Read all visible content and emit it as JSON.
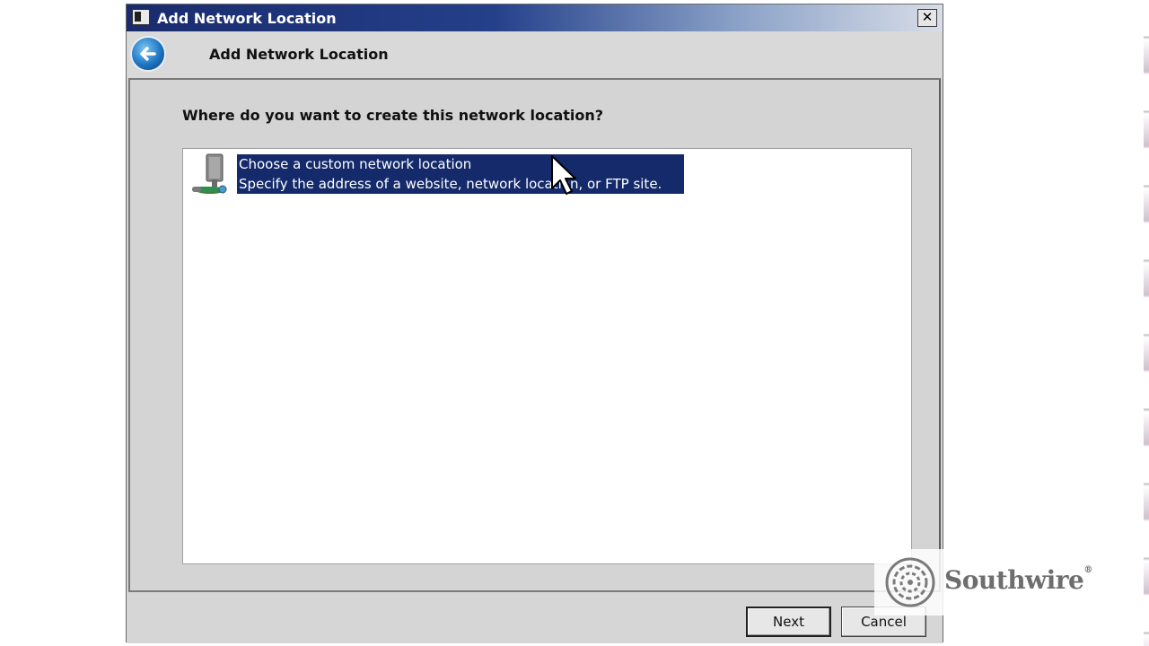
{
  "window": {
    "title": "Add Network Location",
    "close_glyph": "✕"
  },
  "header": {
    "back_icon": "back-arrow-icon",
    "title": "Add Network Location"
  },
  "main": {
    "question": "Where do you want to create this network location?",
    "options": [
      {
        "icon": "network-location-icon",
        "title": "Choose a custom network location",
        "description": "Specify the address of a website, network location, or FTP site.",
        "selected": true
      }
    ]
  },
  "footer": {
    "next_label": "Next",
    "cancel_label": "Cancel"
  },
  "watermark": {
    "brand": "Southwire",
    "reg_mark": "®"
  },
  "colors": {
    "selection": "#142a6a",
    "titlebar_start": "#1a2b6d",
    "dialog_bg": "#d4d4d4"
  }
}
